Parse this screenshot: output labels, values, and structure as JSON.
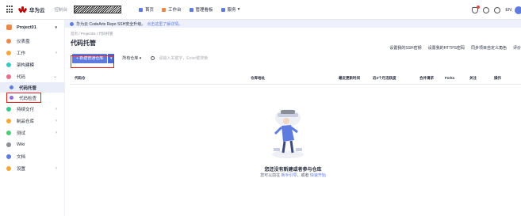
{
  "topbar": {
    "brand": "华为云",
    "console": "控制台",
    "nav": [
      "首页",
      "工作台",
      "管理看板",
      "服务"
    ],
    "lang": "EN"
  },
  "sidebar": {
    "project": "Project01",
    "items": [
      {
        "label": "仪表盘",
        "color": "#e8894b"
      },
      {
        "label": "工作",
        "color": "#f2a93b",
        "chevron": true
      },
      {
        "label": "架构建模",
        "color": "#3ec7c2"
      },
      {
        "label": "代码",
        "color": "#e86f8a",
        "chevron": true,
        "expanded": true
      }
    ],
    "code_sub": [
      {
        "label": "代码托管",
        "color": "#5e7ce0",
        "active": true
      },
      {
        "label": "代码检查",
        "color": "#8a6be0"
      }
    ],
    "items_after": [
      {
        "label": "持续交付",
        "color": "#3ec78a",
        "chevron": true
      },
      {
        "label": "制品仓库",
        "color": "#f2a93b",
        "chevron": true
      },
      {
        "label": "测试",
        "color": "#50c878",
        "chevron": true
      },
      {
        "label": "Wiki",
        "color": "#8a8e99"
      },
      {
        "label": "文档",
        "color": "#5e7ce0"
      },
      {
        "label": "设置",
        "color": "#f2a93b",
        "chevron": true
      }
    ]
  },
  "notice": {
    "text": "华为云 CodeArts Repo SSH安全升级。",
    "link": "点击这里了解详情。"
  },
  "breadcrumb": "首页 / Project01 / 代码托管",
  "page_title": "代码托管",
  "title_links": [
    "设置我的SSH密钥",
    "设置我的HTTPS密码",
    "同步项目自定义角色",
    "评价"
  ],
  "toolbar": {
    "new_repo": "+ 新建普通仓库",
    "filter": "所有仓库",
    "search_placeholder": "请输入关键字，Enter键搜索"
  },
  "table": {
    "headers": [
      "代码仓",
      "仓库地址",
      "最近更新时间",
      "近3个月活跃度",
      "合并请求",
      "Forks",
      "关注",
      "操作"
    ]
  },
  "empty": {
    "title": "您还没有新建或者参与仓库",
    "sub_prefix": "您可以前往 ",
    "sub_link1": "新手引导",
    "sub_mid": "，或者 ",
    "sub_link2": "快速开始"
  }
}
